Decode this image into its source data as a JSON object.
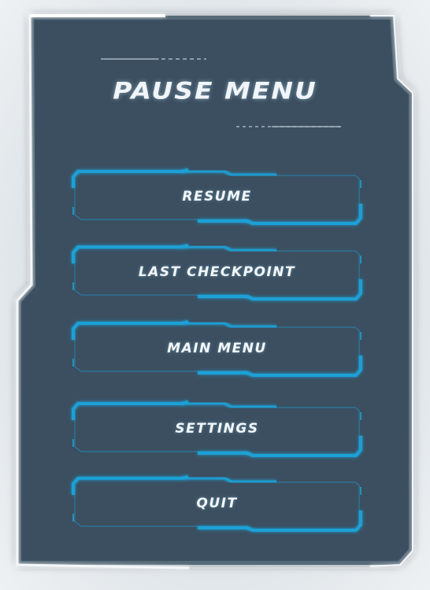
{
  "title": "PAUSE MENU",
  "menu": [
    {
      "label": "RESUME"
    },
    {
      "label": "LAST CHECKPOINT"
    },
    {
      "label": "MAIN MENU"
    },
    {
      "label": "SETTINGS"
    },
    {
      "label": "QUIT"
    }
  ],
  "colors": {
    "panel": "#3a5061",
    "frame": "#f4f6f8",
    "accent": "#1fa0d6",
    "text": "#f3f7fa"
  }
}
